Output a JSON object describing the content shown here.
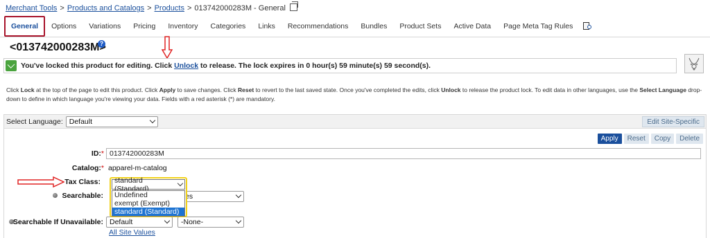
{
  "breadcrumb": {
    "items": [
      "Merchant Tools",
      "Products and Catalogs",
      "Products"
    ],
    "current": "013742000283M - General"
  },
  "tabs": [
    "General",
    "Options",
    "Variations",
    "Pricing",
    "Inventory",
    "Categories",
    "Links",
    "Recommendations",
    "Bundles",
    "Product Sets",
    "Active Data",
    "Page Meta Tag Rules"
  ],
  "page": {
    "title": "<013742000283M>",
    "help_icon": "?"
  },
  "lock": {
    "text_before": "You've locked this product for editing. Click ",
    "unlock_link": "Unlock",
    "text_after": " to release. The lock expires in 0 hour(s) 59 minute(s) 59 second(s)."
  },
  "info": {
    "segments": [
      "Click ",
      "Lock",
      " at the top of the page to edit this product. Click ",
      "Apply",
      " to save changes. Click ",
      "Reset",
      " to revert to the last saved state. Once you've completed the edits, click ",
      "Unlock",
      " to release the product lock. To edit data in other languages, use the ",
      "Select Language",
      " drop-down to define in which language you're viewing your data. Fields with a red asterisk (*) are mandatory."
    ]
  },
  "language": {
    "label": "Select Language:",
    "value": "Default",
    "edit_site_specific": "Edit Site-Specific"
  },
  "actions": {
    "apply": "Apply",
    "reset": "Reset",
    "copy": "Copy",
    "delete": "Delete"
  },
  "fields": {
    "id_label": "ID:",
    "id_value": "013742000283M",
    "catalog_label": "Catalog:",
    "catalog_value": "apparel-m-catalog",
    "tax_label": "Tax Class:",
    "tax_value": "standard (Standard)",
    "tax_options": [
      "Undefined",
      "exempt (Exempt)",
      "standard (Standard)"
    ],
    "searchable_label": "Searchable:",
    "searchable_value": "Yes",
    "searchable_unavail_label": "Searchable If Unavailable:",
    "searchable_unavail_value": "Default",
    "searchable_unavail_site": "-None-",
    "all_site_values": "All Site Values",
    "required_mark": "*"
  },
  "colors": {
    "link": "#1a4f9c",
    "active_tab_border": "#a8132a",
    "annotation_arrow": "#e02424",
    "dropdown_highlight": "#f2d21b",
    "option_selected": "#1e74d2",
    "lock_icon": "#4aa33e"
  },
  "icons": {
    "copy": "copy-icon",
    "help": "help-icon",
    "lock": "lock-check-icon",
    "search_tab": "doc-search-icon",
    "avatar": "necklace-thumbnail-icon",
    "chevron": "chevron-down-icon"
  }
}
